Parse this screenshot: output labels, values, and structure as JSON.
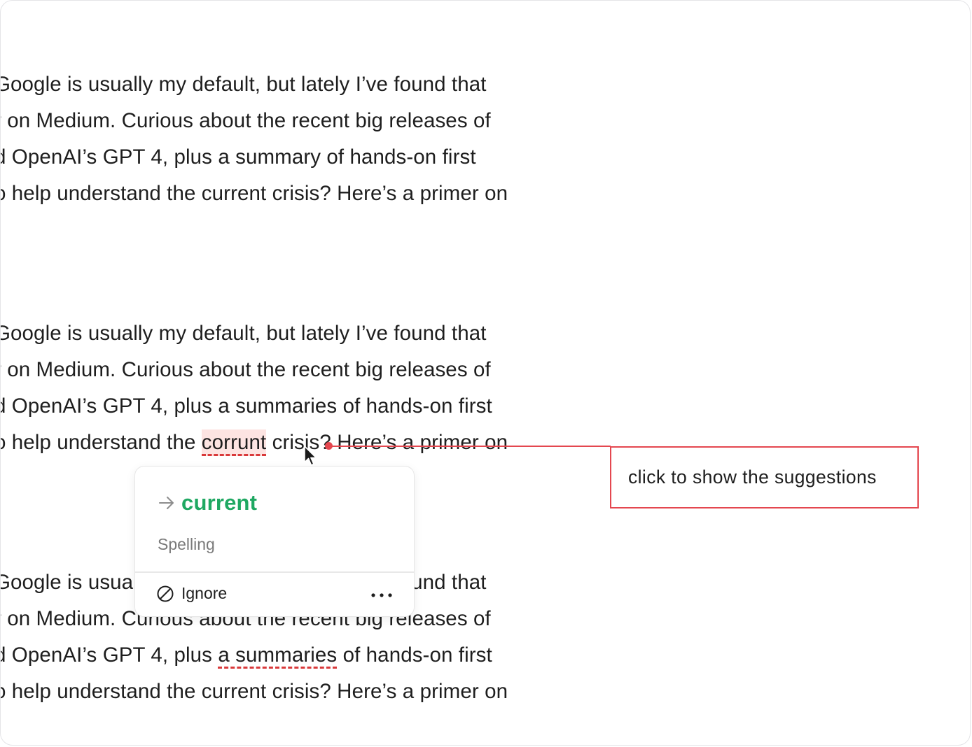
{
  "paragraphs": {
    "first": {
      "lines": [
        "Google is usually my default, but lately I’ve found that",
        "r on Medium. Curious about the recent big releases of",
        "d OpenAI’s GPT 4, plus a summary of hands-on first",
        "o help understand the current crisis? Here’s a primer on"
      ]
    },
    "second": {
      "line1": "Google is usually my default, but lately I’ve found that",
      "line2": "r on Medium. Curious about the recent big releases of",
      "line3": "d OpenAI’s GPT 4, plus a summaries of hands-on first",
      "line4_before": "o help understand the ",
      "line4_error": "corrunt",
      "line4_after": " crisis? Here’s a primer on"
    },
    "third": {
      "line1": "Google is usually my default, but lately I’ve found that",
      "line2": "r on Medium. Curious about the recent big releases of",
      "line3_before": "d OpenAI’s GPT 4, plus ",
      "line3_error": "a summaries",
      "line3_after": " of hands-on first",
      "line4": "o help understand the current crisis? Here’s a primer on"
    }
  },
  "popup": {
    "suggestion": "current",
    "category": "Spelling",
    "ignore_label": "Ignore",
    "icons": {
      "suggestion": "arrow-right-icon",
      "ignore": "ignore-icon",
      "more": "more-options-icon"
    }
  },
  "annotation": {
    "text": "click to show the suggestions"
  },
  "colors": {
    "error_highlight": "#fde4e2",
    "error_underline": "#d9393a",
    "suggestion": "#1fa862",
    "annotation": "#e4474f"
  }
}
